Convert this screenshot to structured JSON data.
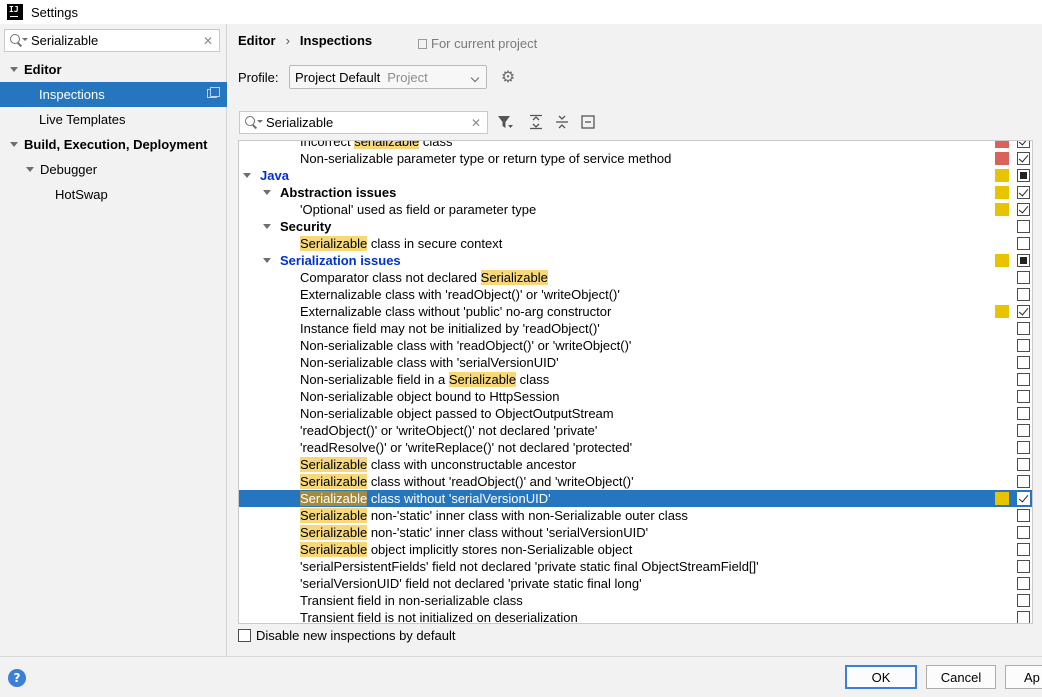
{
  "window": {
    "title": "Settings"
  },
  "sidebar": {
    "search_value": "Serializable",
    "items": [
      {
        "label": "Editor"
      },
      {
        "label": "Inspections"
      },
      {
        "label": "Live Templates"
      },
      {
        "label": "Build, Execution, Deployment"
      },
      {
        "label": "Debugger"
      },
      {
        "label": "HotSwap"
      }
    ]
  },
  "header": {
    "breadcrumb_1": "Editor",
    "breadcrumb_sep": "›",
    "breadcrumb_2": "Inspections",
    "project_note": "For current project"
  },
  "profile": {
    "label": "Profile:",
    "value": "Project Default",
    "sub": "Project"
  },
  "filter": {
    "search_value": "Serializable"
  },
  "colors": {
    "error": "#d9635a",
    "warning": "#e8c400",
    "selection": "#2675bf",
    "highlight": "#f6d77a",
    "link": "#0033cc"
  },
  "rows": [
    {
      "pre": "Incorrect ",
      "hl": "serializable",
      "post": " class",
      "indent": 2,
      "sev": "error",
      "check": "checked"
    },
    {
      "pre": "Non-serializable parameter type or return type of service method",
      "hl": "",
      "post": "",
      "indent": 2,
      "sev": "error",
      "check": "checked"
    },
    {
      "pre": "Java",
      "hl": "",
      "post": "",
      "indent": 0,
      "group": true,
      "blue": true,
      "sev": "warning",
      "check": "mixed"
    },
    {
      "pre": "Abstraction issues",
      "hl": "",
      "post": "",
      "indent": 1,
      "group": true,
      "sev": "warning",
      "check": "checked"
    },
    {
      "pre": "'Optional' used as field or parameter type",
      "hl": "",
      "post": "",
      "indent": 2,
      "sev": "warning",
      "check": "checked"
    },
    {
      "pre": "Security",
      "hl": "",
      "post": "",
      "indent": 1,
      "group": true,
      "sev": "",
      "check": ""
    },
    {
      "pre": "",
      "hl": "Serializable",
      "post": " class in secure context",
      "indent": 2,
      "sev": "",
      "check": ""
    },
    {
      "pre": "Serialization issues",
      "hl": "",
      "post": "",
      "indent": 1,
      "group": true,
      "blue": true,
      "sev": "warning",
      "check": "mixed"
    },
    {
      "pre": "Comparator class not declared ",
      "hl": "Serializable",
      "post": "",
      "indent": 2,
      "sev": "",
      "check": ""
    },
    {
      "pre": "Externalizable class with 'readObject()' or 'writeObject()'",
      "hl": "",
      "post": "",
      "indent": 2,
      "sev": "",
      "check": ""
    },
    {
      "pre": "Externalizable class without 'public' no-arg constructor",
      "hl": "",
      "post": "",
      "indent": 2,
      "sev": "warning",
      "check": "checked"
    },
    {
      "pre": "Instance field may not be initialized by 'readObject()'",
      "hl": "",
      "post": "",
      "indent": 2,
      "sev": "",
      "check": ""
    },
    {
      "pre": "Non-serializable class with 'readObject()' or 'writeObject()'",
      "hl": "",
      "post": "",
      "indent": 2,
      "sev": "",
      "check": ""
    },
    {
      "pre": "Non-serializable class with 'serialVersionUID'",
      "hl": "",
      "post": "",
      "indent": 2,
      "sev": "",
      "check": ""
    },
    {
      "pre": "Non-serializable field in a ",
      "hl": "Serializable",
      "post": " class",
      "indent": 2,
      "sev": "",
      "check": ""
    },
    {
      "pre": "Non-serializable object bound to HttpSession",
      "hl": "",
      "post": "",
      "indent": 2,
      "sev": "",
      "check": ""
    },
    {
      "pre": "Non-serializable object passed to ObjectOutputStream",
      "hl": "",
      "post": "",
      "indent": 2,
      "sev": "",
      "check": ""
    },
    {
      "pre": "'readObject()' or 'writeObject()' not declared 'private'",
      "hl": "",
      "post": "",
      "indent": 2,
      "sev": "",
      "check": ""
    },
    {
      "pre": "'readResolve()' or 'writeReplace()' not declared 'protected'",
      "hl": "",
      "post": "",
      "indent": 2,
      "sev": "",
      "check": ""
    },
    {
      "pre": "",
      "hl": "Serializable",
      "post": " class with unconstructable ancestor",
      "indent": 2,
      "sev": "",
      "check": ""
    },
    {
      "pre": "",
      "hl": "Serializable",
      "post": " class without 'readObject()' and 'writeObject()'",
      "indent": 2,
      "sev": "",
      "check": ""
    },
    {
      "pre": "",
      "hl": "Serializable",
      "post": " class without 'serialVersionUID'",
      "indent": 2,
      "sev": "warning",
      "check": "checked",
      "selected": true
    },
    {
      "pre": "",
      "hl": "Serializable",
      "post": " non-'static' inner class with non-Serializable outer class",
      "indent": 2,
      "sev": "",
      "check": ""
    },
    {
      "pre": "",
      "hl": "Serializable",
      "post": " non-'static' inner class without 'serialVersionUID'",
      "indent": 2,
      "sev": "",
      "check": ""
    },
    {
      "pre": "",
      "hl": "Serializable",
      "post": " object implicitly stores non-Serializable object",
      "indent": 2,
      "sev": "",
      "check": ""
    },
    {
      "pre": "'serialPersistentFields' field not declared 'private static final ObjectStreamField[]'",
      "hl": "",
      "post": "",
      "indent": 2,
      "sev": "",
      "check": ""
    },
    {
      "pre": "'serialVersionUID' field not declared 'private static final long'",
      "hl": "",
      "post": "",
      "indent": 2,
      "sev": "",
      "check": ""
    },
    {
      "pre": "Transient field in non-serializable class",
      "hl": "",
      "post": "",
      "indent": 2,
      "sev": "",
      "check": ""
    },
    {
      "pre": "Transient field is not initialized on deserialization",
      "hl": "",
      "post": "",
      "indent": 2,
      "sev": "",
      "check": ""
    }
  ],
  "options": {
    "disable_new_label": "Disable new inspections by default"
  },
  "footer": {
    "ok": "OK",
    "cancel": "Cancel",
    "apply": "Ap",
    "help": "?"
  }
}
